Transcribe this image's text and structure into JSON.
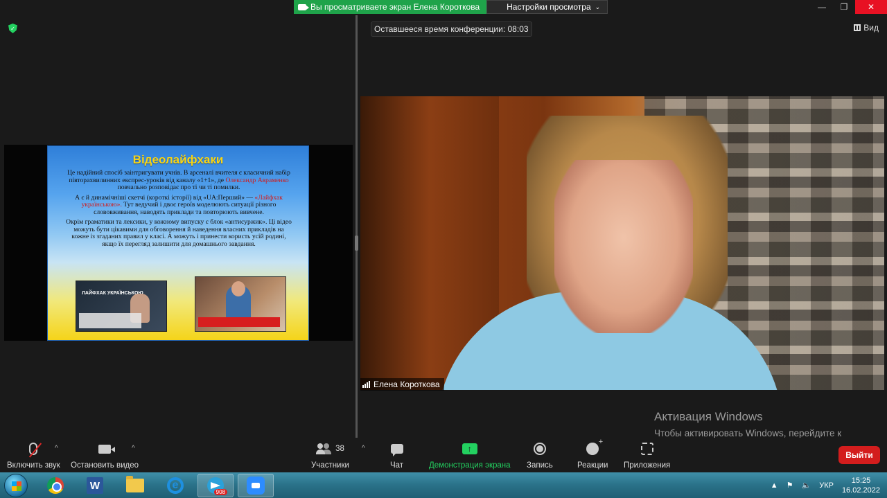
{
  "share_banner": {
    "status": "Вы просматриваете экран Елена Короткова",
    "settings": "Настройки просмотра"
  },
  "window": {
    "minimize": "—",
    "restore": "❐",
    "close": "✕"
  },
  "timer": "Оставшееся время конференции: 08:03",
  "view_button": "Вид",
  "slide": {
    "title": "Відеолайфхаки",
    "p1_a": "Це надійний спосіб заінтригувати учнів. В арсеналі вчителя є класичний набір півторахвилинних експрес-уроків від каналу «1+1», де ",
    "p1_red": "Олександр Авраменко",
    "p1_b": " повчально розповідає про ті чи ті помилки.",
    "p2_a": "А є й динамічніші скетчі (короткі історії) від «UA:Перший» — ",
    "p2_red": "«Лайфхак українською».",
    "p2_b": " Тут ведучий і двоє героїв моделюють ситуації різного слововживання, наводять приклади та повторюють вивчене.",
    "p3": "Окрім граматики та лексики, у кожному випуску є блок «антисуржик». Ці відео можуть бути цікавими для обговорення й наведення власних прикладів на кожне із згаданих правил у класі. А можуть і принести користь усій родині, якщо їх перегляд залишити для домашнього завдання.",
    "thumb1_label": "ЛАЙФХАК УКРАЇНСЬКОЮ"
  },
  "participant": {
    "name": "Елена Короткова"
  },
  "activation": {
    "title": "Активация Windows",
    "text": "Чтобы активировать Windows, перейдите к параметрам компьютера."
  },
  "toolbar": {
    "unmute": "Включить звук",
    "stop_video": "Остановить видео",
    "participants": "Участники",
    "participants_count": "38",
    "chat": "Чат",
    "share_screen": "Демонстрация экрана",
    "record": "Запись",
    "reactions": "Реакции",
    "apps": "Приложения",
    "leave": "Выйти",
    "caret": "^"
  },
  "taskbar": {
    "telegram_badge": "908",
    "word_letter": "W",
    "ie_letter": "e",
    "language": "УКР",
    "time": "15:25",
    "date": "16.02.2022"
  },
  "colors": {
    "zoom_green": "#23d160",
    "leave_red": "#d31d1d",
    "taskbar": "#2a7188"
  }
}
